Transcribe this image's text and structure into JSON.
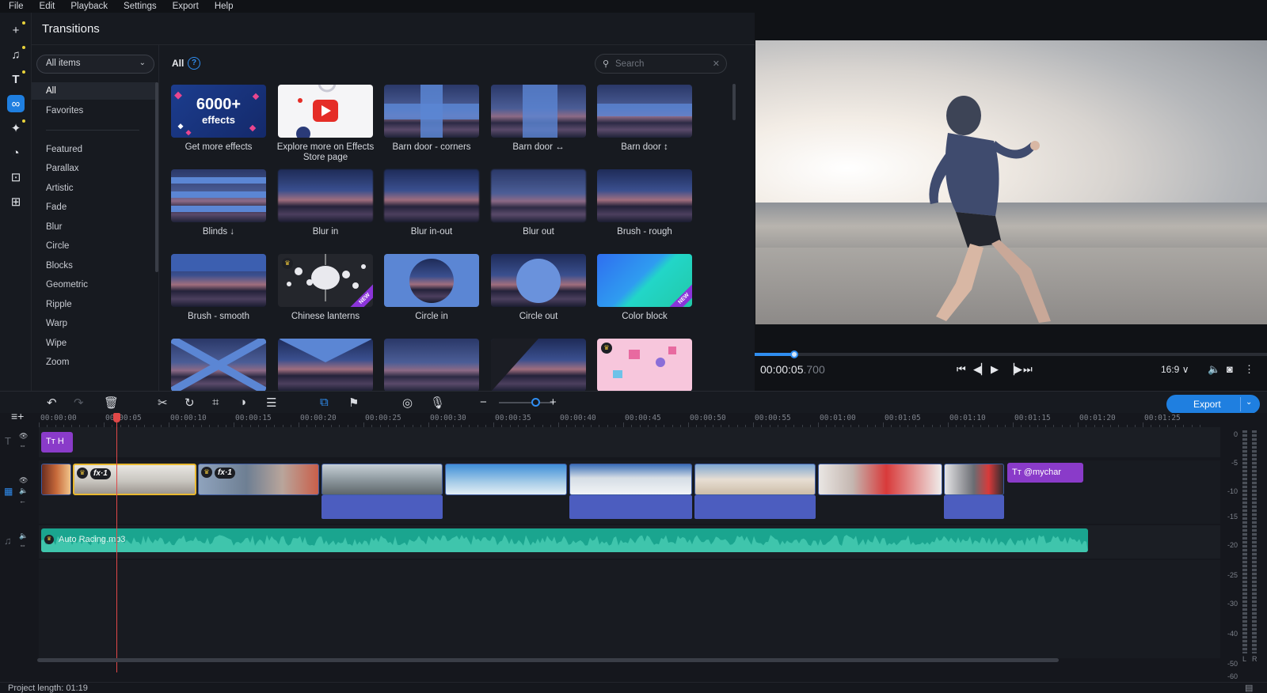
{
  "menu": [
    "File",
    "Edit",
    "Playback",
    "Settings",
    "Export",
    "Help"
  ],
  "rail_icons": [
    "add-media-icon",
    "music-icon",
    "text-icon",
    "transitions-icon",
    "magic-wand-icon",
    "filters-icon",
    "stickers-icon",
    "more-tools-icon"
  ],
  "panel": {
    "title": "Transitions",
    "category_select": "All items",
    "categories_top": [
      "All",
      "Favorites"
    ],
    "categories": [
      "Featured",
      "Parallax",
      "Artistic",
      "Fade",
      "Blur",
      "Circle",
      "Blocks",
      "Geometric",
      "Ripple",
      "Warp",
      "Wipe",
      "Zoom"
    ],
    "grid_heading": "All",
    "help": "?",
    "search_placeholder": "Search",
    "tiles": [
      {
        "label": "Get more effects",
        "big": "6000+",
        "small": "effects"
      },
      {
        "label": "Explore more on Effects Store page"
      },
      {
        "label": "Barn door - corners"
      },
      {
        "label": "Barn door ↔"
      },
      {
        "label": "Barn door ↕"
      },
      {
        "label": "Blinds ↓"
      },
      {
        "label": "Blur in"
      },
      {
        "label": "Blur in-out"
      },
      {
        "label": "Blur out"
      },
      {
        "label": "Brush - rough"
      },
      {
        "label": "Brush - smooth"
      },
      {
        "label": "Chinese lanterns",
        "badge": "NEW"
      },
      {
        "label": "Circle in"
      },
      {
        "label": "Circle out"
      },
      {
        "label": "Color block",
        "badge": "NEW"
      }
    ]
  },
  "preview": {
    "timecode": "00:00:05",
    "timecode_ms": ".700",
    "aspect": "16:9 ∨",
    "progress": 0.07
  },
  "toolbar": {
    "export_label": "Export"
  },
  "timeline": {
    "ruler": [
      "00:00:00",
      "00:00:05",
      "00:00:10",
      "00:00:15",
      "00:00:20",
      "00:00:25",
      "00:00:30",
      "00:00:35",
      "00:00:40",
      "00:00:45",
      "00:00:50",
      "00:00:55",
      "00:01:00",
      "00:01:05",
      "00:01:10",
      "00:01:15",
      "00:01:20",
      "00:01:25"
    ],
    "title_clip": "H",
    "text_clip": "@mychar",
    "fx_badges": [
      "fx·1",
      "fx·1"
    ],
    "audio_name": "Auto Racing.mp3",
    "meter_labels": [
      "0",
      "-5",
      "-10",
      "-15",
      "-20",
      "-25",
      "-30",
      "-40",
      "-50",
      "-60"
    ],
    "meter_lr": [
      "L",
      "R"
    ]
  },
  "status": {
    "project_length": "Project length: 01:19"
  }
}
